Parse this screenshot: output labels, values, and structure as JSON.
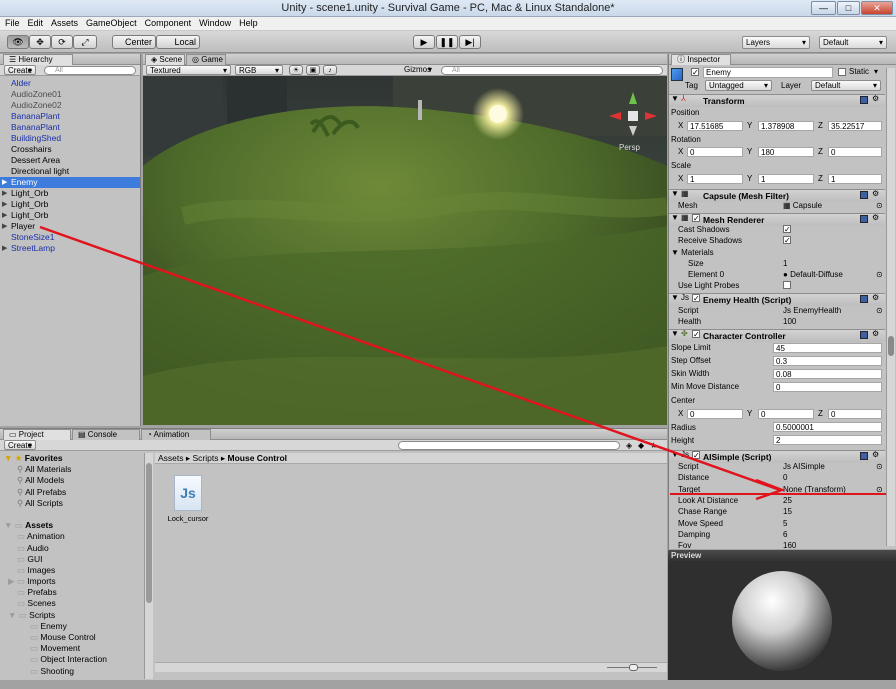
{
  "window": {
    "title": "Unity - scene1.unity - Survival Game - PC, Mac & Linux Standalone*",
    "minimize": "—",
    "maximize": "□",
    "close": "✕"
  },
  "menu": [
    "File",
    "Edit",
    "Assets",
    "GameObject",
    "Component",
    "Window",
    "Help"
  ],
  "toolbar": {
    "center": "Center",
    "local": "Local",
    "layers": "Layers",
    "layout": "Default"
  },
  "hierarchy": {
    "tab": "Hierarchy",
    "create": "Create",
    "search_placeholder": "All",
    "items": [
      {
        "label": "Alder",
        "style": "blue",
        "arrow": ""
      },
      {
        "label": "AudioZone01",
        "style": "gray",
        "arrow": ""
      },
      {
        "label": "AudioZone02",
        "style": "gray",
        "arrow": ""
      },
      {
        "label": "BananaPlant",
        "style": "blue",
        "arrow": ""
      },
      {
        "label": "BananaPlant",
        "style": "blue",
        "arrow": ""
      },
      {
        "label": "BuildingShed",
        "style": "blue",
        "arrow": ""
      },
      {
        "label": "Crosshairs",
        "style": "",
        "arrow": ""
      },
      {
        "label": "Dessert Area",
        "style": "",
        "arrow": ""
      },
      {
        "label": "Directional light",
        "style": "",
        "arrow": ""
      },
      {
        "label": "Enemy",
        "style": "sel",
        "arrow": "▶"
      },
      {
        "label": "Light_Orb",
        "style": "",
        "arrow": "▶"
      },
      {
        "label": "Light_Orb",
        "style": "",
        "arrow": "▶"
      },
      {
        "label": "Light_Orb",
        "style": "",
        "arrow": "▶"
      },
      {
        "label": "Player",
        "style": "",
        "arrow": "▶"
      },
      {
        "label": "StoneSize1",
        "style": "blue",
        "arrow": ""
      },
      {
        "label": "StreetLamp",
        "style": "blue",
        "arrow": "▶"
      }
    ]
  },
  "scene": {
    "tab_scene": "Scene",
    "tab_game": "Game",
    "shading": "Textured",
    "render": "RGB",
    "gizmos": "Gizmos",
    "search_placeholder": "All",
    "persp": "Persp"
  },
  "project": {
    "tab_project": "Project",
    "tab_console": "Console",
    "tab_animation": "Animation",
    "create": "Create",
    "breadcrumb": [
      "Assets",
      "Scripts",
      "Mouse Control"
    ],
    "file": {
      "name": "Lock_cursor",
      "icon_text": "Js"
    },
    "tree": [
      {
        "label": "Favorites",
        "indent": 0,
        "kind": "fav-root"
      },
      {
        "label": "All Materials",
        "indent": 1,
        "kind": "search"
      },
      {
        "label": "All Models",
        "indent": 1,
        "kind": "search"
      },
      {
        "label": "All Prefabs",
        "indent": 1,
        "kind": "search"
      },
      {
        "label": "All Scripts",
        "indent": 1,
        "kind": "search"
      },
      {
        "label": "",
        "indent": 0,
        "kind": "spacer"
      },
      {
        "label": "Assets",
        "indent": 0,
        "kind": "root"
      },
      {
        "label": "Animation",
        "indent": 1,
        "kind": "folder"
      },
      {
        "label": "Audio",
        "indent": 1,
        "kind": "folder"
      },
      {
        "label": "GUI",
        "indent": 1,
        "kind": "folder"
      },
      {
        "label": "Images",
        "indent": 1,
        "kind": "folder"
      },
      {
        "label": "Imports",
        "indent": 1,
        "kind": "folder-arrow"
      },
      {
        "label": "Prefabs",
        "indent": 1,
        "kind": "folder"
      },
      {
        "label": "Scenes",
        "indent": 1,
        "kind": "folder"
      },
      {
        "label": "Scripts",
        "indent": 1,
        "kind": "folder-open"
      },
      {
        "label": "Enemy",
        "indent": 2,
        "kind": "folder"
      },
      {
        "label": "Mouse Control",
        "indent": 2,
        "kind": "folder"
      },
      {
        "label": "Movement",
        "indent": 2,
        "kind": "folder"
      },
      {
        "label": "Object Interaction",
        "indent": 2,
        "kind": "folder"
      },
      {
        "label": "Shooting",
        "indent": 2,
        "kind": "folder"
      }
    ]
  },
  "inspector": {
    "tab": "Inspector",
    "object_name": "Enemy",
    "static_label": "Static",
    "tag_label": "Tag",
    "tag_value": "Untagged",
    "layer_label": "Layer",
    "layer_value": "Default",
    "transform": {
      "title": "Transform",
      "position_label": "Position",
      "position": [
        "17.51685",
        "1.378908",
        "35.22517"
      ],
      "rotation_label": "Rotation",
      "rotation": [
        "0",
        "180",
        "0"
      ],
      "scale_label": "Scale",
      "scale": [
        "1",
        "1",
        "1"
      ],
      "axes": [
        "X",
        "Y",
        "Z"
      ]
    },
    "mesh_filter": {
      "title": "Capsule (Mesh Filter)",
      "mesh_label": "Mesh",
      "mesh_value": "Capsule"
    },
    "mesh_renderer": {
      "title": "Mesh Renderer",
      "cast_shadows": "Cast Shadows",
      "receive_shadows": "Receive Shadows",
      "materials": "Materials",
      "size_label": "Size",
      "size_value": "1",
      "element_label": "Element 0",
      "element_value": "Default-Diffuse",
      "light_probes": "Use Light Probes"
    },
    "enemy_health": {
      "title": "Enemy Health (Script)",
      "script_label": "Script",
      "script_value": "EnemyHealth",
      "health_label": "Health",
      "health_value": "100"
    },
    "character_controller": {
      "title": "Character Controller",
      "slope_label": "Slope Limit",
      "slope_value": "45",
      "step_label": "Step Offset",
      "step_value": "0.3",
      "skin_label": "Skin Width",
      "skin_value": "0.08",
      "minmove_label": "Min Move Distance",
      "minmove_value": "0",
      "center_label": "Center",
      "center": [
        "0",
        "0",
        "0"
      ],
      "radius_label": "Radius",
      "radius_value": "0.5000001",
      "height_label": "Height",
      "height_value": "2"
    },
    "ai_simple": {
      "title": "AISimple (Script)",
      "rows": [
        {
          "label": "Script",
          "value": "AISimple"
        },
        {
          "label": "Distance",
          "value": "0"
        },
        {
          "label": "Target",
          "value": "None (Transform)"
        },
        {
          "label": "Look At Distance",
          "value": "25"
        },
        {
          "label": "Chase Range",
          "value": "15"
        },
        {
          "label": "Move Speed",
          "value": "5"
        },
        {
          "label": "Damping",
          "value": "6"
        },
        {
          "label": "Fov",
          "value": "160"
        }
      ]
    },
    "preview": "Preview"
  },
  "colors": {
    "selection": "#3d7bdc",
    "annotation": "#e0141c",
    "prefab_blue": "#1a2fa8"
  }
}
